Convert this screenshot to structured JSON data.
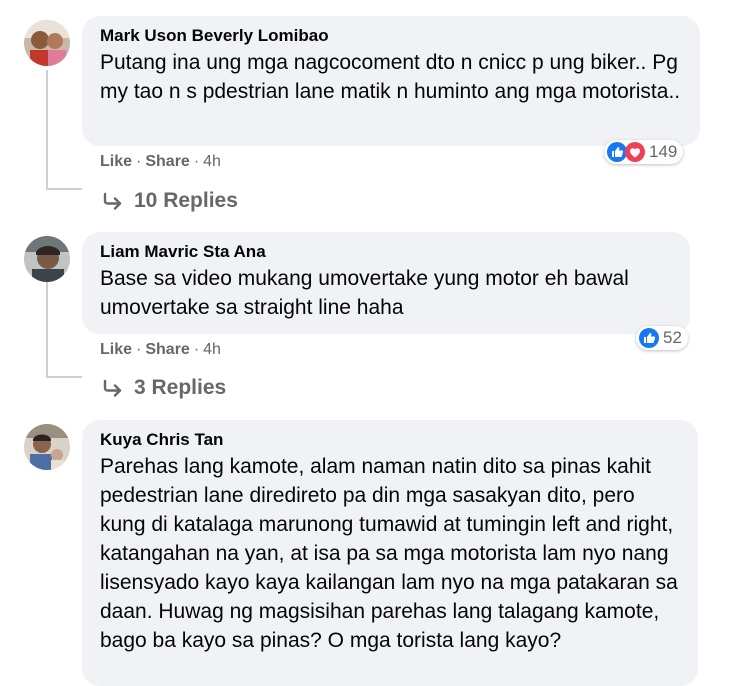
{
  "comments": [
    {
      "author": "Mark Uson Beverly Lomibao",
      "text": "Putang ina ung mga nagcocoment dto n cnicc p ung biker.. Pg my tao n s pdestrian lane matik n huminto ang mga motorista..",
      "reactions": {
        "icons": [
          "like-icon",
          "love-icon"
        ],
        "count": "149"
      },
      "like_label": "Like",
      "share_label": "Share",
      "time": "4h",
      "replies_label": "10 Replies"
    },
    {
      "author": "Liam Mavric Sta Ana",
      "text": "Base sa video mukang umovertake yung motor eh bawal umovertake sa straight line haha",
      "reactions": {
        "icons": [
          "like-icon"
        ],
        "count": "52"
      },
      "like_label": "Like",
      "share_label": "Share",
      "time": "4h",
      "replies_label": "3 Replies"
    },
    {
      "author": "Kuya Chris Tan",
      "text": "Parehas lang kamote, alam naman natin dito sa pinas kahit pedestrian lane diredireto pa din mga sasakyan dito, pero kung di katalaga marunong tumawid at tumingin left and right, katangahan na yan, at isa pa sa mga motorista lam nyo nang lisensyado kayo kaya kailangan lam nyo na mga patakaran sa daan. Huwag ng magsisihan parehas lang talagang kamote, bago ba kayo sa pinas? O mga torista lang kayo?"
    }
  ],
  "separator": "·",
  "colors": {
    "bubble": "#f0f2f5",
    "like_blue": "#1877f2",
    "love_red": "#f33e58",
    "meta_gray": "#65676b"
  }
}
